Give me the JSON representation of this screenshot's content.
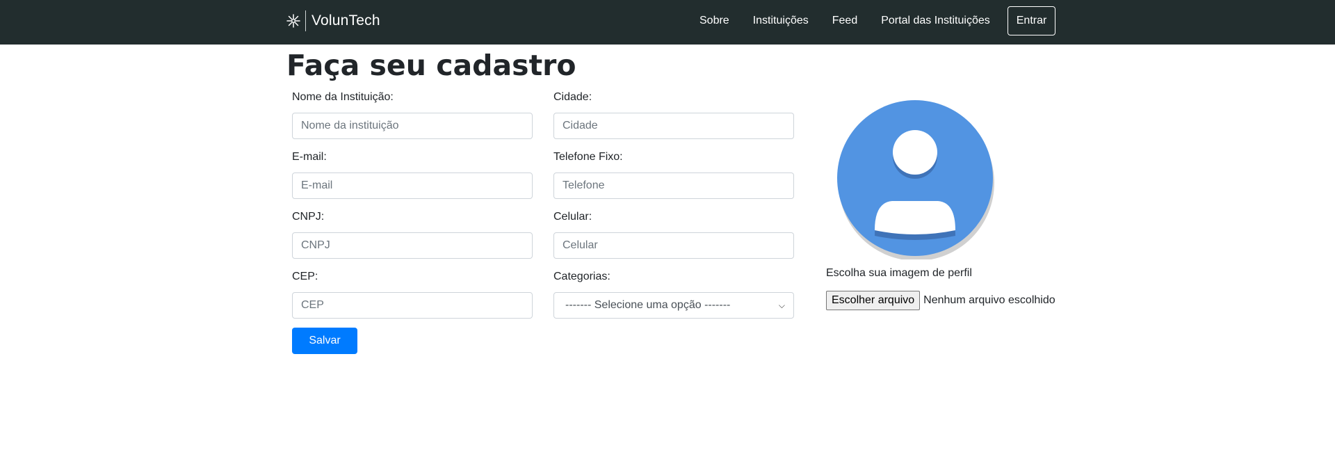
{
  "navbar": {
    "brand": "VolunTech",
    "links": [
      "Sobre",
      "Instituições",
      "Feed",
      "Portal das Instituições"
    ],
    "login_button": "Entrar"
  },
  "page": {
    "title": "Faça seu cadastro"
  },
  "form": {
    "nome": {
      "label": "Nome da Instituição:",
      "placeholder": "Nome da instituição"
    },
    "cidade": {
      "label": "Cidade:",
      "placeholder": "Cidade"
    },
    "email": {
      "label": "E-mail:",
      "placeholder": "E-mail"
    },
    "telefone": {
      "label": "Telefone Fixo:",
      "placeholder": "Telefone"
    },
    "cnpj": {
      "label": "CNPJ:",
      "placeholder": "CNPJ"
    },
    "celular": {
      "label": "Celular:",
      "placeholder": "Celular"
    },
    "cep": {
      "label": "CEP:",
      "placeholder": "CEP"
    },
    "categorias": {
      "label": "Categorias:",
      "selected": "------- Selecione uma opção -------"
    },
    "save_button": "Salvar"
  },
  "profile": {
    "label": "Escolha sua imagem de perfil",
    "file_button": "Escolher arquivo",
    "file_status": "Nenhum arquivo escolhido"
  },
  "icons": {
    "brand_logo": "asterisk-logo-icon",
    "avatar": "user-avatar-icon",
    "dropdown": "chevron-down-icon"
  },
  "colors": {
    "navbar_bg": "#222d2e",
    "primary": "#007bff",
    "avatar_blue": "#5294e2",
    "avatar_shadow": "#d0d0d0"
  }
}
